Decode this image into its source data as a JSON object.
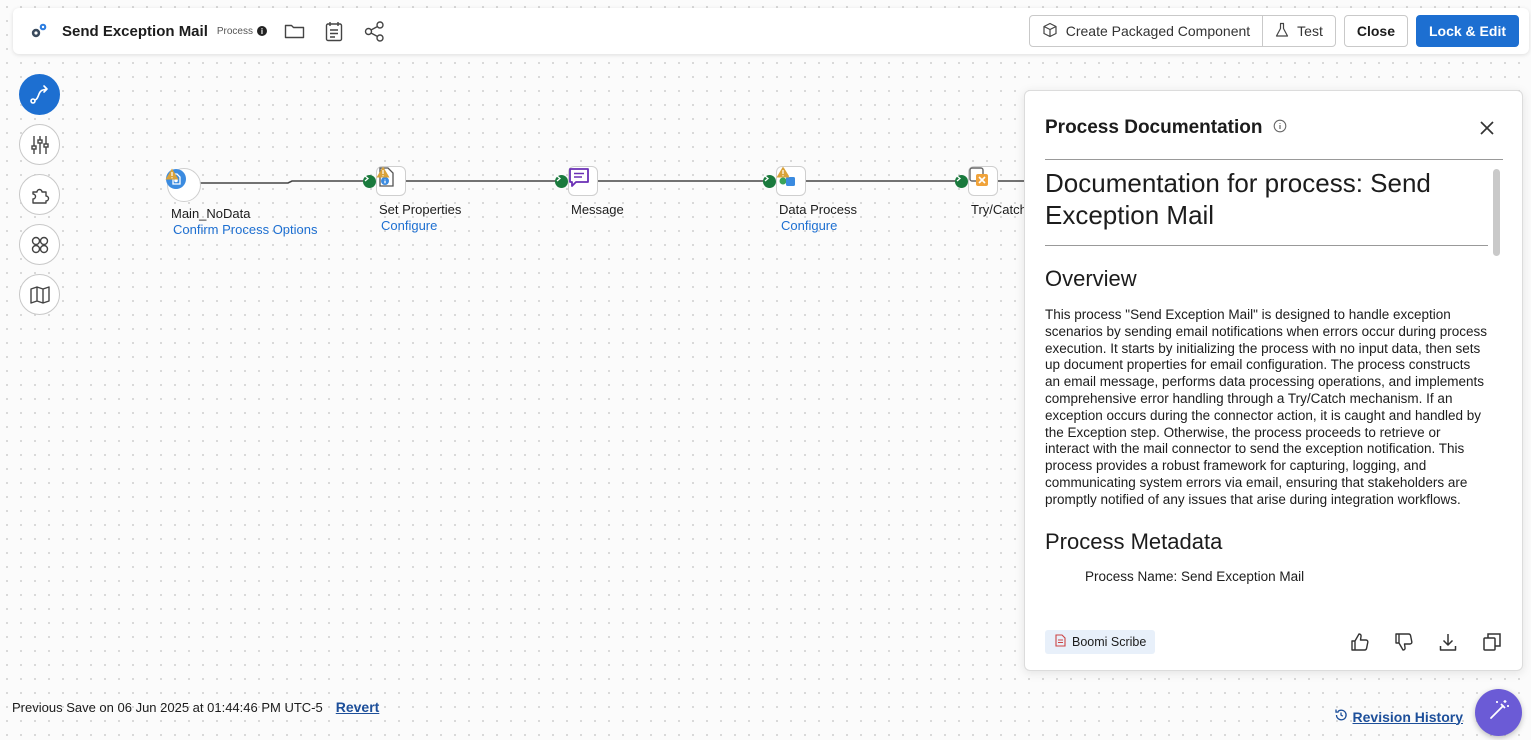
{
  "header": {
    "title": "Send Exception Mail",
    "type_label": "Process",
    "info_glyph": "i",
    "create_packaged_label": "Create Packaged Component",
    "test_label": "Test",
    "close_label": "Close",
    "lock_edit_label": "Lock & Edit",
    "icons": [
      "process-gear-icon",
      "folder-icon",
      "notes-icon",
      "share-icon"
    ]
  },
  "rail": {
    "items": [
      "build-icon",
      "settings-sliders-icon",
      "extensions-icon",
      "components-icon",
      "map-icon"
    ]
  },
  "canvas": {
    "shapes": [
      {
        "label": "Main_NoData",
        "warning": "Confirm Process Options",
        "icon": "start-noData-icon"
      },
      {
        "label": "Set Properties",
        "warning": "Configure",
        "icon": "set-properties-icon"
      },
      {
        "label": "Message",
        "warning": "",
        "icon": "message-icon"
      },
      {
        "label": "Data Process",
        "warning": "Configure",
        "icon": "data-process-icon"
      },
      {
        "label": "Try/Catch",
        "warning": "",
        "icon": "try-catch-icon"
      }
    ]
  },
  "panel": {
    "title": "Process Documentation",
    "doc_title": "Documentation for process: Send Exception Mail",
    "overview_heading": "Overview",
    "overview_text": "This process \"Send Exception Mail\" is designed to handle exception scenarios by sending email notifications when errors occur during process execution. It starts by initializing the process with no input data, then sets up document properties for email configuration. The process constructs an email message, performs data processing operations, and implements comprehensive error handling through a Try/Catch mechanism. If an exception occurs during the connector action, it is caught and handled by the Exception step. Otherwise, the process proceeds to retrieve or interact with the mail connector to send the exception notification. This process provides a robust framework for capturing, logging, and communicating system errors via email, ensuring that stakeholders are promptly notified of any issues that arise during integration workflows.",
    "metadata_heading": "Process Metadata",
    "metadata_first_line": "Process Name: Send Exception Mail",
    "scribe_label": "Boomi Scribe",
    "footer_actions": [
      "thumbs-up-icon",
      "thumbs-down-icon",
      "download-icon",
      "copy-icon"
    ]
  },
  "footer": {
    "save_text": "Previous Save on 06 Jun 2025 at 01:44:46 PM UTC-5",
    "revert_label": "Revert",
    "revision_history_label": "Revision History"
  },
  "colors": {
    "primary": "#1d6fd1",
    "link": "#1d4f9a",
    "connector_green": "#1a7a3d",
    "warning": "#d9a23a",
    "fab": "#6b5bd6"
  }
}
